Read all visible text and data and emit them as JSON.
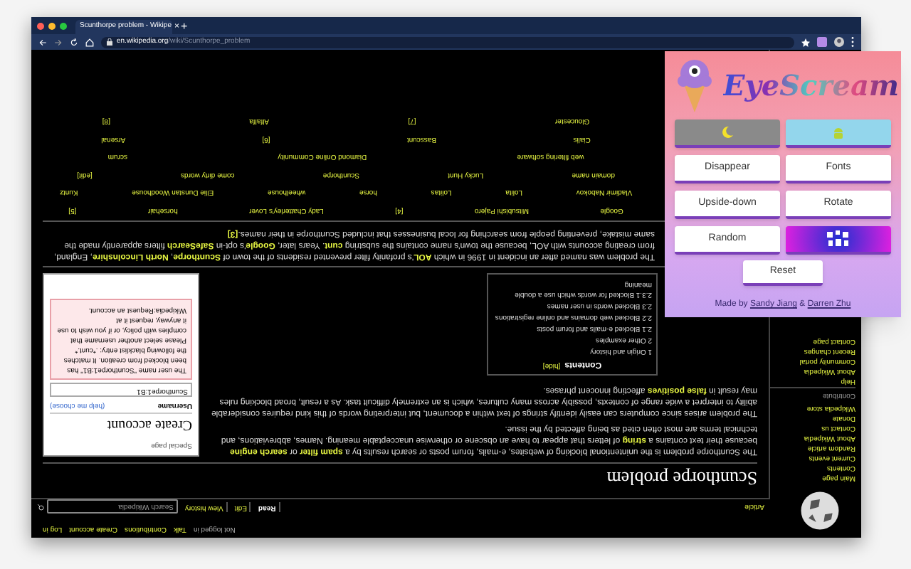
{
  "browser": {
    "tab_title": "Scunthorpe problem - Wikipe",
    "tab_close": "×",
    "new_tab": "+",
    "url_domain": "en.wikipedia.org",
    "url_path": "/wiki/Scunthorpe_problem"
  },
  "page": {
    "personal_tools": [
      "Not logged in",
      "Talk",
      "Contributions",
      "Create account",
      "Log in"
    ],
    "view_tabs": [
      {
        "label": "Read",
        "selected": true
      },
      {
        "label": "Edit",
        "selected": false
      },
      {
        "label": "View history",
        "selected": false
      }
    ],
    "search_placeholder": "Search Wikipedia",
    "sidebar": {
      "navigation": [
        "Main page",
        "Contents",
        "Current events",
        "Random article",
        "About Wikipedia",
        "Contact us",
        "Donate",
        "Wikipedia store"
      ],
      "contribute_heading": "Contribute",
      "contribute": [
        "Help",
        "About Wikipedia",
        "Community portal",
        "Recent changes",
        "Contact page"
      ]
    },
    "namespace_tab": "Article",
    "title": "Scunthorpe problem",
    "intro": [
      [
        {
          "text": "The Scunthorpe problem is the unintentional blocking of websites, e-mails, forum posts or search results by a ",
          "link": false
        },
        {
          "text": "spam filter",
          "link": true
        },
        {
          "text": " or ",
          "link": false
        },
        {
          "text": "search engine",
          "link": true
        },
        {
          "text": " because their text contains a ",
          "link": false
        },
        {
          "text": "string",
          "link": true
        },
        {
          "text": " of letters that appear to have an obscene or otherwise unacceptable meaning. Names, abbreviations, and technical terms are most often cited as being affected by the issue.",
          "link": false
        }
      ],
      [
        {
          "text": "The problem arises since computers can easily identify strings of text within a document, but interpreting words of this kind requires considerable ability to interpret a wide range of contexts, possibly across many cultures, which is an extremely difficult task. As a result, broad blocking rules may result in ",
          "link": false
        },
        {
          "text": "false positives",
          "link": true
        },
        {
          "text": " affecting innocent phrases.",
          "link": false
        }
      ]
    ],
    "contents": {
      "heading": "Contents",
      "toggle": "[hide]",
      "items": [
        "1 Origin and history",
        "2 Other examples",
        "2.1 Blocked e-mails and forum posts",
        "2.2 Blocked web domains and online registrations",
        "2.3 Blocked words in user names",
        "2.3.1 Blocked for words which use a double meaning"
      ]
    },
    "account_preview": {
      "label": "Special page",
      "heading": "Create account",
      "username_label": "Username",
      "help_link": "(help me choose)",
      "username_value": "Scunthorpe1:B1",
      "warning": "The user name \"Scunthorpe1:B1\" has been blocked from creation. It matches the following blacklist entry: .*cunt.* Please select another username that complies with policy, or if you wish to use it anyway, request it at Wikipedia:Request an account."
    },
    "history": [
      [
        {
          "text": "The problem was named after an incident in 1996 in which ",
          "link": false
        },
        {
          "text": "AOL",
          "link": true
        },
        {
          "text": "'s profanity filter prevented residents of the town of ",
          "link": false
        },
        {
          "text": "Scunthorpe",
          "link": true
        },
        {
          "text": ", ",
          "link": false
        },
        {
          "text": "North Lincolnshire",
          "link": true
        },
        {
          "text": ", England, from creating accounts with AOL, because the town's name contains the substring ",
          "link": false
        },
        {
          "text": "cunt",
          "link": true
        },
        {
          "text": ". Years later, ",
          "link": false
        },
        {
          "text": "Google",
          "link": true
        },
        {
          "text": "'s opt-in ",
          "link": false
        },
        {
          "text": "SafeSearch",
          "link": true
        },
        {
          "text": " filters apparently made the same mistake, preventing people from searching for local businesses that included Scunthorpe in their names.",
          "link": false
        },
        {
          "text": "[3]",
          "link": true
        }
      ]
    ],
    "examples_table": [
      [
        "Google",
        "Mitsubishi Pajero",
        "[4]",
        "Lady Chatterley's Lover",
        "horsehair",
        "[5]"
      ],
      [
        "Vladimir Nabokov",
        "Lolita",
        "Lolitas",
        "horse",
        "wheelhouse",
        "Ellie Dunstan Woodhouse",
        "Kuntz"
      ],
      [
        "domain name",
        "Lucky Hunt",
        "Scunthorpe",
        "come dirty words",
        "[edit]"
      ],
      [
        "web filtering software",
        "Diamond Online Community",
        "scrum"
      ],
      [
        "Cialis",
        "Basscunt",
        "[6]",
        "Arsenal"
      ],
      [
        "Gloucester",
        "[7]",
        "Alfalfa",
        "[8]"
      ]
    ]
  },
  "popup": {
    "title": "EyeScream",
    "buttons": [
      {
        "kind": "dark"
      },
      {
        "kind": "android"
      },
      {
        "kind": "text",
        "label": "Disappear"
      },
      {
        "kind": "text",
        "label": "Fonts"
      },
      {
        "kind": "text",
        "label": "Upside-down"
      },
      {
        "kind": "text",
        "label": "Rotate"
      },
      {
        "kind": "text",
        "label": "Random"
      },
      {
        "kind": "pattern"
      }
    ],
    "reset": "Reset",
    "credit_prefix": "Made by ",
    "credit_author_1": "Sandy Jiang",
    "credit_join": " & ",
    "credit_author_2": "Darren Zhu"
  }
}
